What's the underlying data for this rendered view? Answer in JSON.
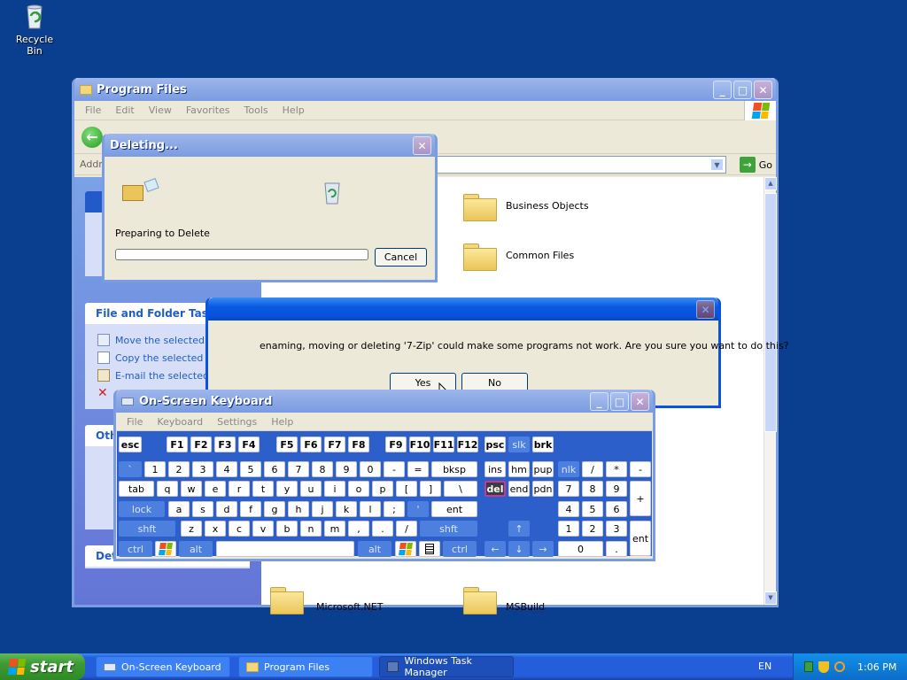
{
  "desktop": {
    "recycle_bin_label": "Recycle Bin"
  },
  "explorer": {
    "title": "Program Files",
    "menu": [
      "File",
      "Edit",
      "View",
      "Favorites",
      "Tools",
      "Help"
    ],
    "address_label": "Address",
    "go_label": "Go",
    "panels": {
      "file_folder_tasks": {
        "title": "File and Folder Tasks",
        "items": [
          "Move the selected items",
          "Copy the selected items",
          "E-mail the selected items"
        ]
      },
      "other_places_title_partial": "Oth",
      "details_title_partial": "Det"
    },
    "folders": [
      "Business Objects",
      "Common Files",
      "Microsoft.NET",
      "MSBuild"
    ]
  },
  "deleting_dialog": {
    "title": "Deleting...",
    "status": "Preparing to Delete",
    "progress": 0,
    "cancel_label": "Cancel"
  },
  "confirm_dialog": {
    "message": "enaming, moving or deleting '7-Zip' could make some programs not work. Are you sure you want to do this?",
    "yes_label": "Yes",
    "no_label": "No"
  },
  "osk": {
    "title": "On-Screen Keyboard",
    "menu": [
      "File",
      "Keyboard",
      "Settings",
      "Help"
    ]
  },
  "taskbar": {
    "start_label": "start",
    "tasks": [
      "On-Screen Keyboard",
      "Program Files",
      "Windows Task Manager"
    ],
    "language": "EN",
    "clock": "1:06 PM"
  },
  "colors": {
    "desktop": "#0a3f8f",
    "titlebar_active": "#0a5ae0",
    "task_link": "#215dc6",
    "taskbar": "#245edb",
    "start_green": "#3c9a33"
  }
}
